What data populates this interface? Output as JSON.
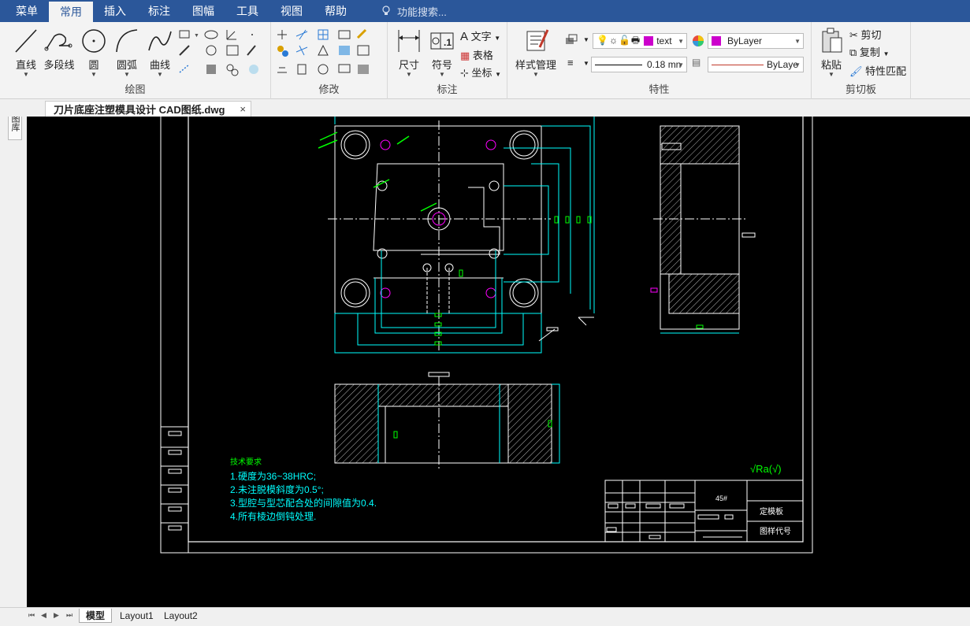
{
  "menubar": {
    "items": [
      "菜单",
      "常用",
      "插入",
      "标注",
      "图幅",
      "工具",
      "视图",
      "帮助"
    ],
    "active_index": 1,
    "search_placeholder": "功能搜索..."
  },
  "ribbon": {
    "draw": {
      "label": "绘图",
      "tools": [
        "直线",
        "多段线",
        "圆",
        "圆弧",
        "曲线"
      ]
    },
    "modify": {
      "label": "修改"
    },
    "annotate": {
      "label": "标注",
      "dimension": "尺寸",
      "symbol": "符号",
      "text": "文字",
      "table": "表格",
      "coordinate": "坐标"
    },
    "properties": {
      "label": "特性",
      "style_manager": "样式管理",
      "layer_name": "text",
      "color_value": "ByLayer",
      "lineweight": "0.18 mn",
      "linetype": "ByLaye"
    },
    "clipboard": {
      "label": "剪切板",
      "paste": "粘贴",
      "cut": "剪切",
      "copy": "复制",
      "match_props": "特性匹配"
    }
  },
  "document": {
    "tab_title": "刀片底座注塑模具设计 CAD图纸.dwg",
    "close_glyph": "×"
  },
  "left_strip": {
    "label": "图库"
  },
  "drawing": {
    "tech_req_title": "技术要求",
    "tech_req": [
      "1.硬度为36~38HRC;",
      "2.未注脱模斜度为0.5°;",
      "3.型腔与型芯配合处的间隙值为0.4.",
      "4.所有棱边倒钝处理."
    ],
    "roughness": "√Ra(√)",
    "title_block": {
      "material": "45#",
      "part_name": "定模板",
      "drawing_no_label": "图样代号"
    }
  },
  "layout_tabs": [
    "模型",
    "Layout1",
    "Layout2"
  ],
  "colors": {
    "menubar": "#2b579a",
    "canvas": "#000000",
    "cyan": "#00ffff",
    "green": "#00ff00",
    "magenta": "#ff00ff",
    "white": "#ffffff",
    "layer_swatch": "#cc00cc"
  }
}
